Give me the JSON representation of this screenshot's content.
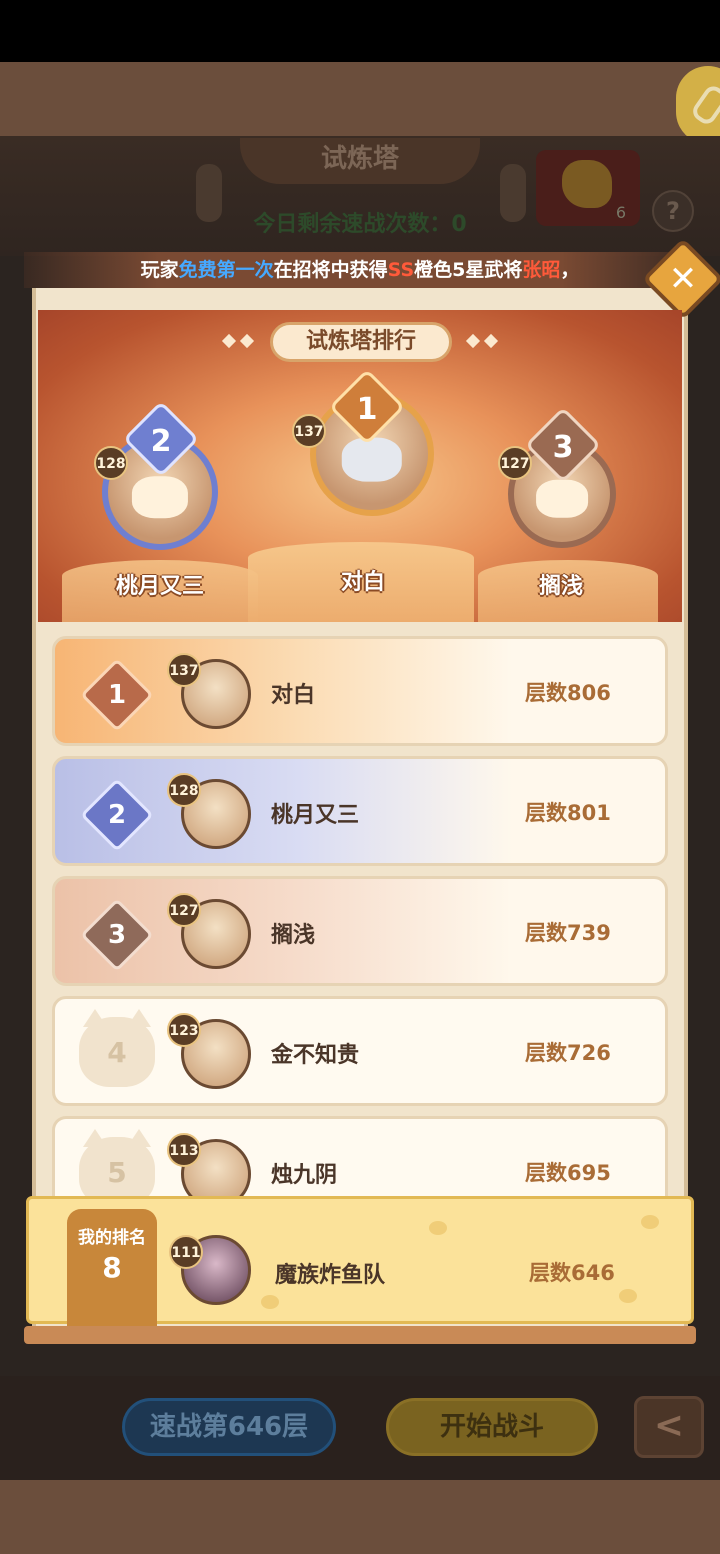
{
  "header": {
    "title": "试炼塔",
    "remaining_label": "今日剩余速战次数：",
    "remaining_value": "0",
    "resource_count": "6",
    "help_icon": "?"
  },
  "banner": {
    "part1": "玩家",
    "part2": "免费第一次",
    "part3": "在招将中获得",
    "part4": "SS",
    "part5": "橙色5星武将",
    "part6": "张昭",
    "part7": "，"
  },
  "ranking": {
    "title": "试炼塔排行",
    "podium": [
      {
        "rank": "2",
        "level": "128",
        "name": "桃月又三"
      },
      {
        "rank": "1",
        "level": "137",
        "name": "对白"
      },
      {
        "rank": "3",
        "level": "127",
        "name": "搁浅"
      }
    ],
    "rows": [
      {
        "rank": "1",
        "level": "137",
        "name": "对白",
        "score": "层数806"
      },
      {
        "rank": "2",
        "level": "128",
        "name": "桃月又三",
        "score": "层数801"
      },
      {
        "rank": "3",
        "level": "127",
        "name": "搁浅",
        "score": "层数739"
      },
      {
        "rank": "4",
        "level": "123",
        "name": "金不知贵",
        "score": "层数726"
      },
      {
        "rank": "5",
        "level": "113",
        "name": "烛九阴",
        "score": "层数695"
      }
    ],
    "me": {
      "label": "我的排名",
      "rank": "8",
      "level": "111",
      "name": "魔族炸鱼队",
      "score": "层数646"
    }
  },
  "buttons": {
    "sweep": "速战第646层",
    "start": "开始战斗",
    "back": "<"
  },
  "colors": {
    "gold": "#e7a53e",
    "first": "#f7b574",
    "second": "#b9bfe6",
    "third": "#ecc2a8"
  }
}
